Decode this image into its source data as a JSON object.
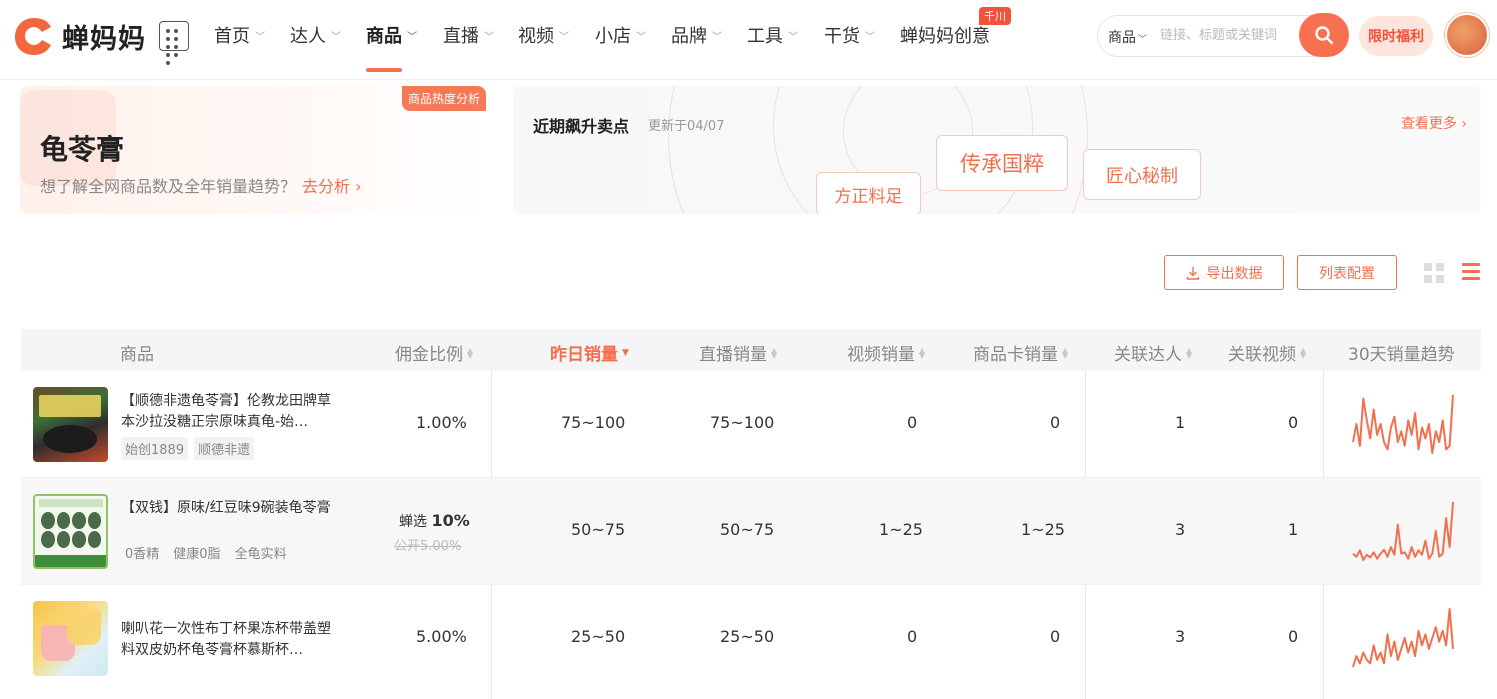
{
  "brand": {
    "name": "蝉妈妈"
  },
  "nav": {
    "items": [
      {
        "label": "首页",
        "has_menu": true
      },
      {
        "label": "达人",
        "has_menu": true
      },
      {
        "label": "商品",
        "has_menu": true,
        "active": true
      },
      {
        "label": "直播",
        "has_menu": true
      },
      {
        "label": "视频",
        "has_menu": true
      },
      {
        "label": "小店",
        "has_menu": true
      },
      {
        "label": "品牌",
        "has_menu": true
      },
      {
        "label": "工具",
        "has_menu": true
      },
      {
        "label": "干货",
        "has_menu": true
      },
      {
        "label": "蝉妈妈创意",
        "has_menu": false
      }
    ],
    "badge": "千川"
  },
  "search": {
    "type": "商品",
    "placeholder": "链接、标题或关键词"
  },
  "promo": {
    "label": "限时福利"
  },
  "keyword_card": {
    "tag": "商品热度分析",
    "title": "龟苓膏",
    "subtitle": "想了解全网商品数及全年销量趋势？",
    "link": "去分析"
  },
  "selling_points": {
    "title": "近期飙升卖点",
    "updated": "更新于04/07",
    "more": "查看更多",
    "points": [
      "方正料足",
      "传承国粹",
      "匠心秘制"
    ]
  },
  "toolbar": {
    "export": "导出数据",
    "config": "列表配置"
  },
  "table": {
    "columns": [
      "商品",
      "佣金比例",
      "昨日销量",
      "直播销量",
      "视频销量",
      "商品卡销量",
      "关联达人",
      "关联视频",
      "30天销量趋势"
    ],
    "rows": [
      {
        "title": "【顺德非遗龟苓膏】伦教龙田牌草本沙拉没糖正宗原味真龟-始…",
        "tags": [
          "始创1889",
          "顺德非遗"
        ],
        "commission": "1.00%",
        "yesterday": "75~100",
        "live": "75~100",
        "video": "0",
        "card": "0",
        "creators": "1",
        "videos": "0",
        "trend": [
          30,
          55,
          25,
          90,
          60,
          35,
          75,
          40,
          55,
          30,
          20,
          50,
          65,
          30,
          45,
          25,
          60,
          40,
          70,
          20,
          50,
          35,
          55,
          15,
          45,
          30,
          60,
          20,
          25,
          95
        ]
      },
      {
        "title": "【双钱】原味/红豆味9碗装龟苓膏",
        "tags": [
          "0香精",
          "健康0脂",
          "全龟实料"
        ],
        "commission_label": "蝉选",
        "commission": "10%",
        "commission_public": "公开5.00%",
        "yesterday": "50~75",
        "live": "50~75",
        "video": "1~25",
        "card": "1~25",
        "creators": "3",
        "videos": "1",
        "trend": [
          20,
          15,
          25,
          10,
          18,
          14,
          22,
          12,
          20,
          26,
          15,
          30,
          18,
          65,
          20,
          22,
          12,
          30,
          15,
          25,
          18,
          40,
          12,
          20,
          55,
          15,
          20,
          75,
          30,
          100
        ]
      },
      {
        "title": "喇叭花一次性布丁杯果冻杯带盖塑料双皮奶杯龟苓膏杯慕斯杯…",
        "tags": [],
        "commission": "5.00%",
        "yesterday": "25~50",
        "live": "25~50",
        "video": "0",
        "card": "0",
        "creators": "3",
        "videos": "0",
        "trend": [
          10,
          25,
          15,
          30,
          20,
          15,
          40,
          20,
          30,
          15,
          55,
          25,
          45,
          20,
          35,
          50,
          30,
          45,
          25,
          60,
          40,
          55,
          35,
          50,
          65,
          45,
          60,
          40,
          90,
          35
        ]
      }
    ]
  },
  "colors": {
    "accent": "#f2704e",
    "badge": "#f2523a"
  }
}
